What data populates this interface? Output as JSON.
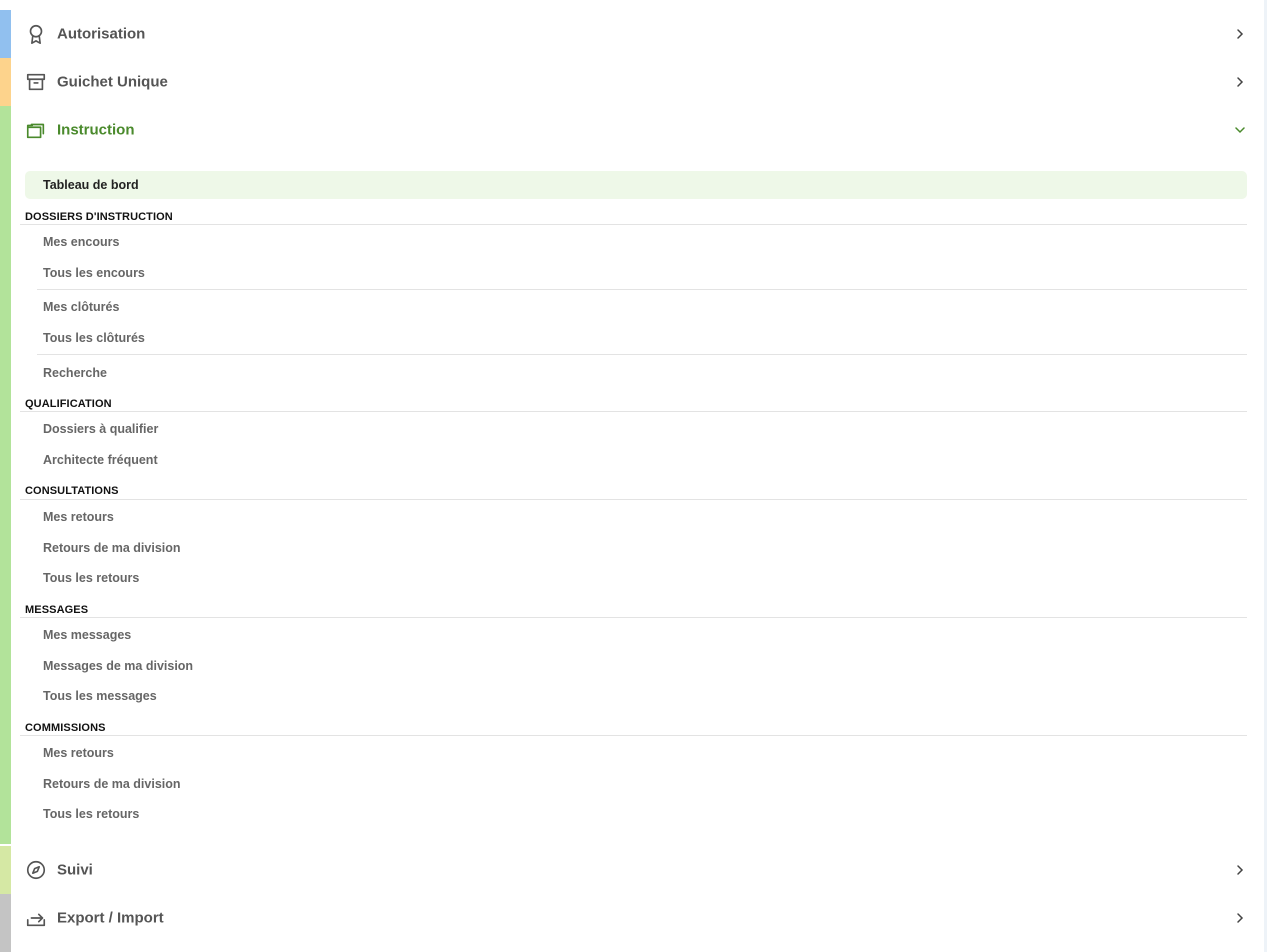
{
  "colors": {
    "accent_autorisation": "#91c0ef",
    "accent_guichet": "#fdd38c",
    "accent_instruction": "#b2e39a",
    "accent_suivi": "#d5e8a4",
    "accent_export": "#c4c4c4",
    "active_label": "#4a8a2c",
    "active_item_bg": "#eef8e8"
  },
  "menu": {
    "autorisation": {
      "label": "Autorisation",
      "icon": "award-icon",
      "state": "collapsed"
    },
    "guichet": {
      "label": "Guichet Unique",
      "icon": "archive-box-icon",
      "state": "collapsed"
    },
    "instruction": {
      "label": "Instruction",
      "icon": "folders-icon",
      "state": "expanded"
    },
    "suivi": {
      "label": "Suivi",
      "icon": "compass-icon",
      "state": "collapsed"
    },
    "export": {
      "label": "Export / Import",
      "icon": "export-arrow-icon",
      "state": "collapsed"
    }
  },
  "instruction": {
    "dashboard": "Tableau de bord",
    "sections": {
      "dossiers": {
        "title": "DOSSIERS D'INSTRUCTION",
        "items": [
          "Mes encours",
          "Tous les encours",
          "Mes clôturés",
          "Tous les clôturés",
          "Recherche"
        ]
      },
      "qualification": {
        "title": "QUALIFICATION",
        "items": [
          "Dossiers à qualifier",
          "Architecte fréquent"
        ]
      },
      "consultations": {
        "title": "CONSULTATIONS",
        "items": [
          "Mes retours",
          "Retours de ma division",
          "Tous les retours"
        ]
      },
      "messages": {
        "title": "MESSAGES",
        "items": [
          "Mes messages",
          "Messages de ma division",
          "Tous les messages"
        ]
      },
      "commissions": {
        "title": "COMMISSIONS",
        "items": [
          "Mes retours",
          "Retours de ma division",
          "Tous les retours"
        ]
      }
    }
  }
}
